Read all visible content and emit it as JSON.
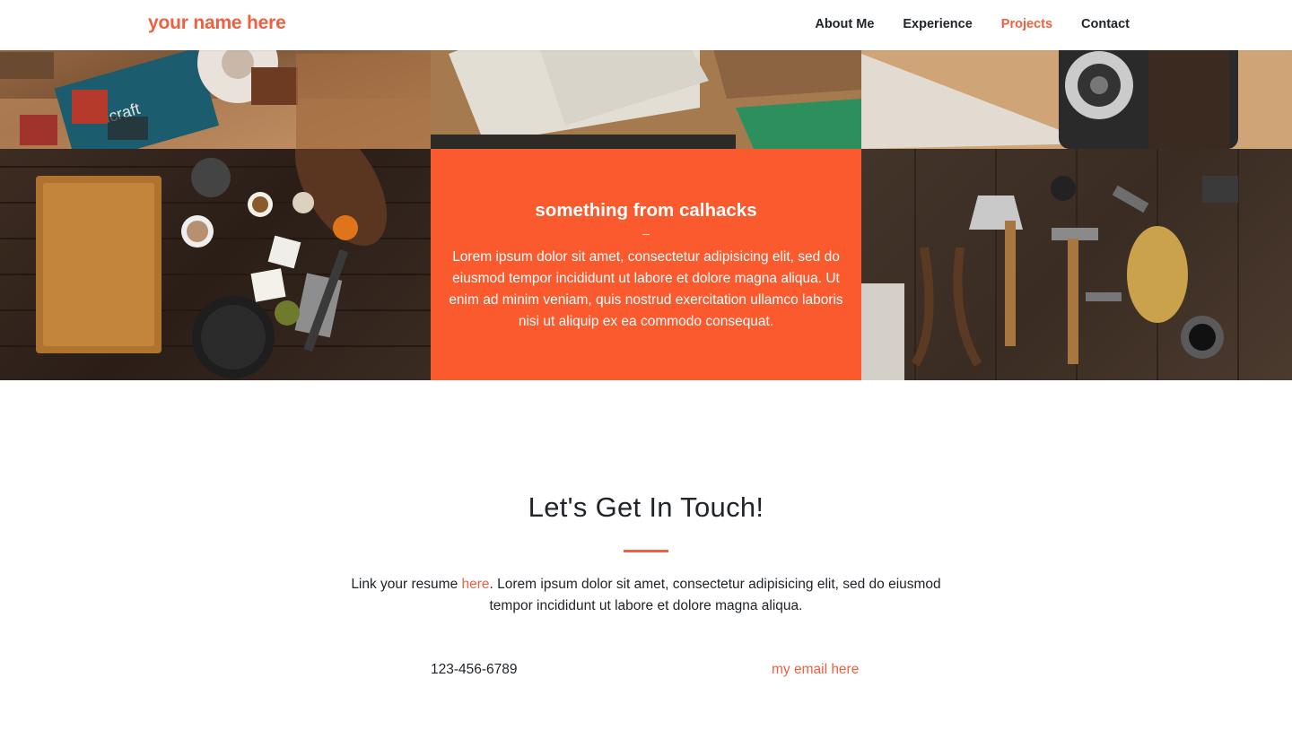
{
  "navbar": {
    "brand": "your name here",
    "links": [
      {
        "label": "About Me",
        "active": false
      },
      {
        "label": "Experience",
        "active": false
      },
      {
        "label": "Projects",
        "active": true
      },
      {
        "label": "Contact",
        "active": false
      }
    ]
  },
  "portfolio": {
    "tiles": [
      {
        "image": "stationery-flatlay-image"
      },
      {
        "image": "paper-booklets-image"
      },
      {
        "image": "vintage-camera-image"
      },
      {
        "image": "kitchen-flatlay-image"
      },
      {
        "image": "project-overlay"
      },
      {
        "image": "tools-flatlay-image"
      }
    ],
    "featured": {
      "title": "something from calhacks",
      "separator": "–",
      "description": "Lorem ipsum dolor sit amet, consectetur adipisicing elit, sed do eiusmod tempor incididunt ut labore et dolore magna aliqua. Ut enim ad minim veniam, quis nostrud exercitation ullamco laboris nisi ut aliquip ex ea commodo consequat."
    }
  },
  "contact": {
    "heading": "Let's Get In Touch!",
    "text_before": "Link your resume ",
    "link_label": "here",
    "text_after": ". Lorem ipsum dolor sit amet, consectetur adipisicing elit, sed do eiusmod tempor incididunt ut labore et dolore magna aliqua.",
    "phone": "123-456-6789",
    "email": "my email here"
  },
  "colors": {
    "accent": "#f05f40",
    "overlay": "#fb5a2e"
  }
}
